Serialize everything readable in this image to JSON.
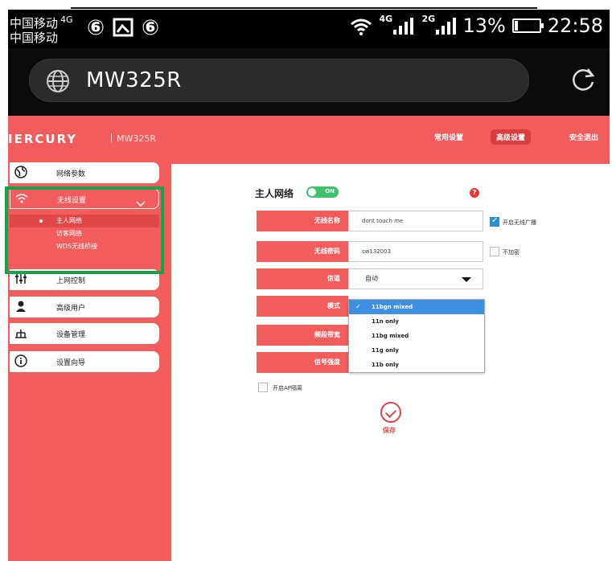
{
  "status_bar": {
    "carrier_1": "中国移动",
    "carrier_1_tag": "4G",
    "carrier_2": "中国移动",
    "net_1": "4G",
    "net_2": "2G",
    "battery": "13%",
    "battery_level": 0.13,
    "time": "22:58"
  },
  "browser": {
    "url": "MW325R"
  },
  "router_header": {
    "logo": "IERCURY",
    "model": "MW325R",
    "nav": [
      "常用设置",
      "高级设置",
      "安全退出"
    ],
    "active_nav_index": 1
  },
  "sidebar": {
    "items": [
      {
        "label": "网络参数",
        "icon": "globe-icon"
      },
      {
        "label": "无线设置",
        "icon": "wifi-icon"
      },
      {
        "label": "上网控制",
        "icon": "sliders-icon"
      },
      {
        "label": "高级用户",
        "icon": "user-icon"
      },
      {
        "label": "设备管理",
        "icon": "device-icon"
      },
      {
        "label": "设置向导",
        "icon": "info-icon"
      }
    ],
    "submenu": [
      "主人网络",
      "访客网络",
      "WDS无线桥接"
    ],
    "selected_sub_index": 0
  },
  "content": {
    "title": "主人网络",
    "toggle": "ON",
    "fields": [
      {
        "label": "无线名称",
        "value": "dont touch me"
      },
      {
        "label": "无线密码",
        "value": "sw132003"
      }
    ],
    "broadcast_checkbox": "开启无线广播",
    "no_encrypt_checkbox": "不加密",
    "rows": [
      {
        "label": "信道",
        "value": "自动"
      },
      {
        "label": "模式",
        "value": ""
      },
      {
        "label": "频段带宽",
        "value": ""
      },
      {
        "label": "信号强度",
        "value": ""
      }
    ],
    "mode_options": [
      "11bgn mixed",
      "11n only",
      "11bg mixed",
      "11g only",
      "11b only"
    ],
    "selected_mode_index": 0,
    "ap_checkbox": "开启AP隔离",
    "save_label": "保存"
  },
  "colors": {
    "brand_red": "#f25c5c",
    "highlight_green": "#16a34a",
    "toggle_green": "#3cc26b",
    "select_blue": "#3d8fe0"
  }
}
